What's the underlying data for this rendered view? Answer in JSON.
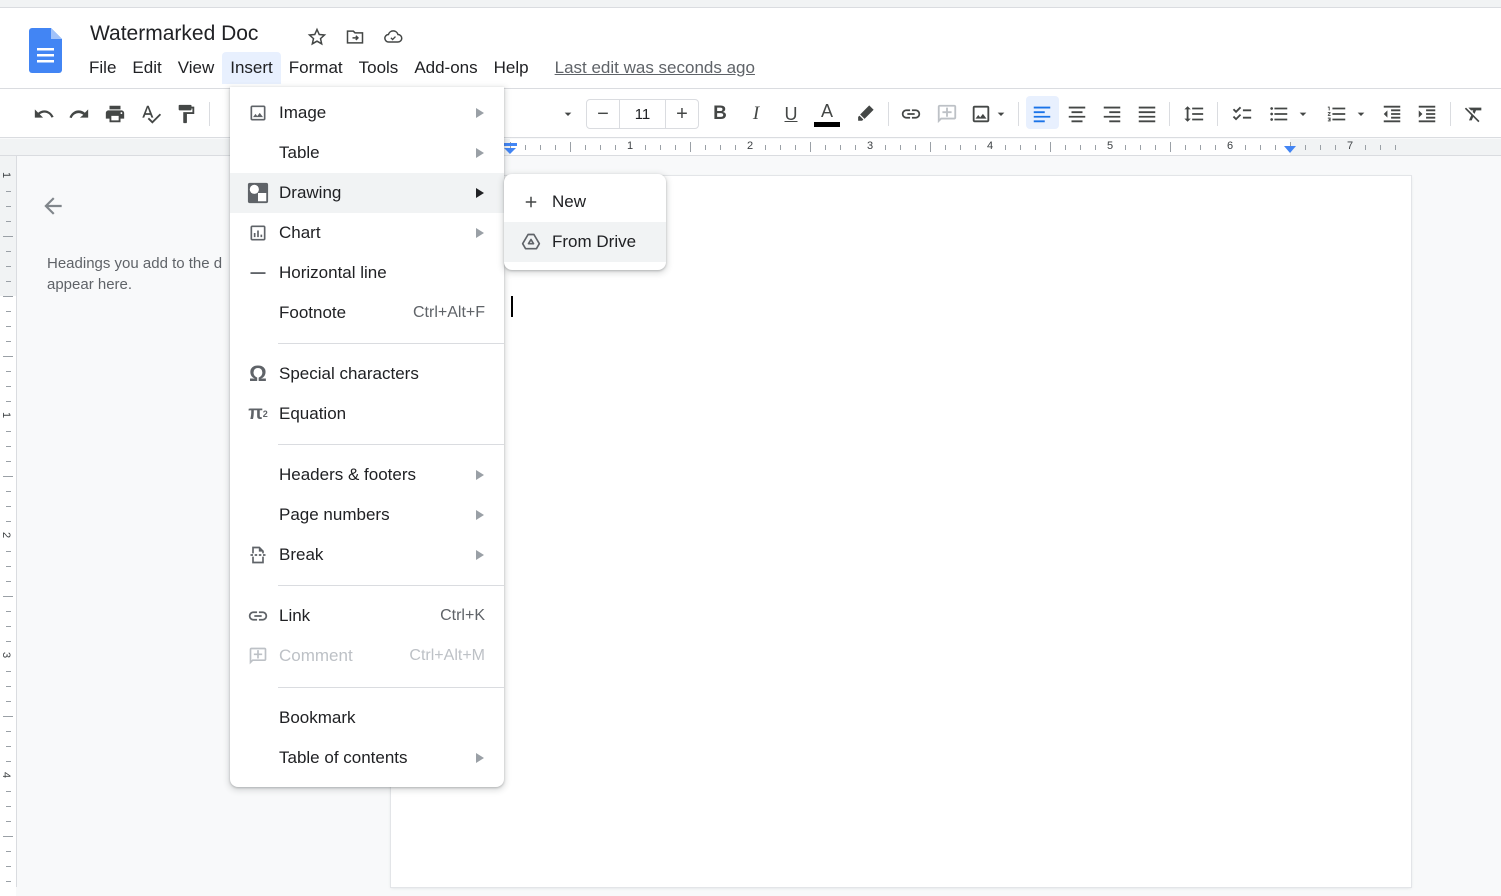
{
  "app": {
    "doc_title": "Watermarked Doc",
    "last_edit": "Last edit was seconds ago"
  },
  "menubar": {
    "items": [
      {
        "label": "File"
      },
      {
        "label": "Edit"
      },
      {
        "label": "View"
      },
      {
        "label": "Insert",
        "active": true
      },
      {
        "label": "Format"
      },
      {
        "label": "Tools"
      },
      {
        "label": "Add-ons"
      },
      {
        "label": "Help"
      }
    ]
  },
  "toolbar": {
    "font_size": "11",
    "text_color": "#000000",
    "icons": [
      "undo-icon",
      "redo-icon",
      "print-icon",
      "spellcheck-icon",
      "paint-format-icon",
      "decrease-font-icon",
      "increase-font-icon",
      "bold-icon",
      "italic-icon",
      "underline-icon",
      "text-color-icon",
      "highlight-icon",
      "link-icon",
      "add-comment-icon",
      "insert-image-icon",
      "align-left-icon",
      "align-center-icon",
      "align-right-icon",
      "justify-icon",
      "line-spacing-icon",
      "checklist-icon",
      "bulleted-list-icon",
      "numbered-list-icon",
      "decrease-indent-icon",
      "increase-indent-icon",
      "clear-formatting-icon"
    ]
  },
  "ruler": {
    "horizontal_numbers": [
      "1",
      "2",
      "3",
      "4",
      "5",
      "6",
      "7"
    ],
    "vertical_numbers": [
      "1",
      "1",
      "2",
      "3",
      "4"
    ]
  },
  "outline": {
    "text_line1": "Headings you add to the d",
    "text_line2": "appear here."
  },
  "insert_menu": {
    "items": [
      {
        "label": "Image",
        "icon": "image-icon",
        "submenu": true
      },
      {
        "label": "Table",
        "icon": "",
        "submenu": true
      },
      {
        "label": "Drawing",
        "icon": "drawing-icon",
        "submenu": true,
        "hover": true
      },
      {
        "label": "Chart",
        "icon": "chart-icon",
        "submenu": true
      },
      {
        "label": "Horizontal line",
        "icon": "horizontal-line-icon"
      },
      {
        "label": "Footnote",
        "shortcut": "Ctrl+Alt+F"
      },
      {
        "label": "Special characters",
        "icon": "omega-icon"
      },
      {
        "label": "Equation",
        "icon": "pi-icon"
      },
      {
        "label": "Headers & footers",
        "submenu": true
      },
      {
        "label": "Page numbers",
        "submenu": true
      },
      {
        "label": "Break",
        "icon": "page-break-icon",
        "submenu": true
      },
      {
        "label": "Link",
        "icon": "link-icon",
        "shortcut": "Ctrl+K"
      },
      {
        "label": "Comment",
        "icon": "add-comment-icon",
        "shortcut": "Ctrl+Alt+M",
        "disabled": true
      },
      {
        "label": "Bookmark"
      },
      {
        "label": "Table of contents",
        "submenu": true
      }
    ]
  },
  "drawing_submenu": {
    "items": [
      {
        "label": "New",
        "icon": "plus-icon"
      },
      {
        "label": "From Drive",
        "icon": "drive-icon",
        "hover": true
      }
    ]
  }
}
